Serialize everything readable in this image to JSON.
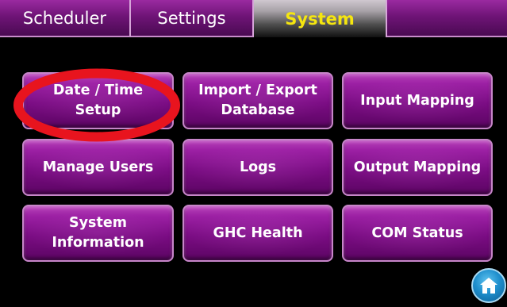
{
  "tabs": [
    {
      "label": "Scheduler",
      "active": false
    },
    {
      "label": "Settings",
      "active": false
    },
    {
      "label": "System",
      "active": true
    },
    {
      "label": "",
      "active": false
    }
  ],
  "buttons": {
    "date_time_setup": "Date / Time\nSetup",
    "import_export_database": "Import / Export\nDatabase",
    "input_mapping": "Input Mapping",
    "manage_users": "Manage Users",
    "logs": "Logs",
    "output_mapping": "Output Mapping",
    "system_information": "System\nInformation",
    "ghc_health": "GHC Health",
    "com_status": "COM Status"
  },
  "icons": {
    "home": "home-icon",
    "highlight": "red-annotation-ellipse"
  },
  "colors": {
    "button_purple": "#8a1592",
    "active_tab_text": "#f5e60f",
    "annotation_red": "#e8141e",
    "home_blue": "#1f8fcd"
  }
}
